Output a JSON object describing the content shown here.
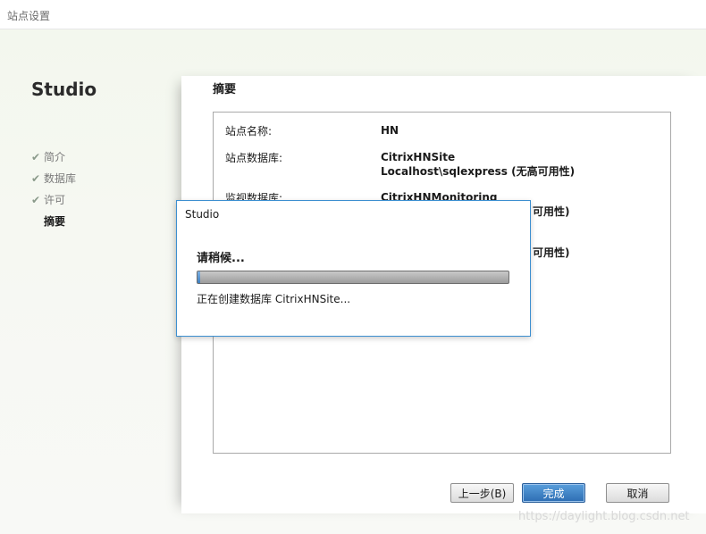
{
  "window": {
    "title": "站点设置"
  },
  "wizard": {
    "brand": "Studio",
    "steps": [
      {
        "label": "简介",
        "done": true
      },
      {
        "label": "数据库",
        "done": true
      },
      {
        "label": "许可",
        "done": true
      },
      {
        "label": "摘要",
        "done": false,
        "current": true
      }
    ]
  },
  "summary": {
    "heading": "摘要",
    "rows": [
      {
        "label": "站点名称:",
        "value1": "HN",
        "value2": ""
      },
      {
        "label": "站点数据库:",
        "value1": "CitrixHNSite",
        "value2": "Localhost\\sqlexpress (无高可用性)"
      },
      {
        "label": "监视数据库:",
        "value1": "CitrixHNMonitoring",
        "value2": "可用性)"
      },
      {
        "label": "",
        "value1": "",
        "value2": "可用性)"
      }
    ]
  },
  "buttons": {
    "back": "上一步(B)",
    "finish": "完成",
    "cancel": "取消"
  },
  "dialog": {
    "title": "Studio",
    "wait_text": "请稍候...",
    "progress_fraction": 0.01,
    "status_text": "正在创建数据库 CitrixHNSite..."
  },
  "watermark": "https://daylight.blog.csdn.net"
}
